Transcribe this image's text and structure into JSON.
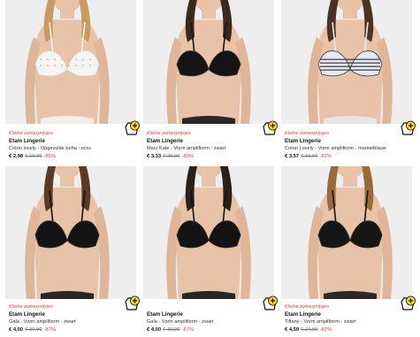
{
  "products": [
    {
      "promo": "",
      "brand": "",
      "name": "",
      "price": "€ 2,98",
      "old_price": "€ 19,90",
      "discount": "-85%",
      "bra_color": "#f4f4f0",
      "accent": "#d9d9d9",
      "icon": "wishlist-plus-icon"
    },
    {
      "promo": "Kleine zomerprijsjes",
      "brand": "Etam Lingerie",
      "name": "Mary Kate - Vorm amplifiorm - zwart",
      "price": "€ 3,33",
      "old_price": "€ 29,90",
      "discount": "-89%",
      "bra_color": "#151515",
      "accent": "#333333",
      "icon": "wishlist-plus-icon"
    },
    {
      "promo": "Kleine zomerprijsjes",
      "brand": "Etam Lingerie",
      "name": "Coton Lovely - Vorm amplifiorm - marineblauw",
      "price": "€ 3,57",
      "old_price": "€ 19,90",
      "discount": "-82%",
      "bra_color": "#e9e9ee",
      "accent": "#2b3550",
      "icon": "wishlist-plus-icon"
    },
    {
      "promo": "Kleine zomerprijsjes",
      "brand": "Etam Lingerie",
      "name": "Gala - Vorm amplifiorm - zwart",
      "price": "€ 4,00",
      "old_price": "€ 30,90",
      "discount": "-87%",
      "bra_color": "#141414",
      "accent": "#2a2a2a",
      "icon": "wishlist-plus-icon"
    },
    {
      "promo": "",
      "brand": "Etam Lingerie",
      "name": "Gala - Vorm amplifiorm - zwart",
      "price": "€ 4,00",
      "old_price": "€ 30,90",
      "discount": "-87%",
      "bra_color": "#141414",
      "accent": "#2a2a2a",
      "icon": "wishlist-plus-icon"
    },
    {
      "promo": "Kleine zomerprijsjes",
      "brand": "Etam Lingerie",
      "name": "Tiffany - Vorm amplifiorm - zwart",
      "price": "€ 4,59",
      "old_price": "€ 24,99",
      "discount": "-82%",
      "bra_color": "#161616",
      "accent": "#2d2d2d",
      "icon": "wishlist-plus-icon"
    }
  ],
  "top_row_extra": {
    "promo": "Kleine zomerprijsjes",
    "brand": "Etam Lingerie",
    "name": "Coton lovely - Opgevulde beha - ecru"
  },
  "colors": {
    "promo_red": "#e0403a",
    "wishlist_yellow": "#ffd21e",
    "skin": "#e8c3a7",
    "photo_bg": "#eeeeee"
  }
}
